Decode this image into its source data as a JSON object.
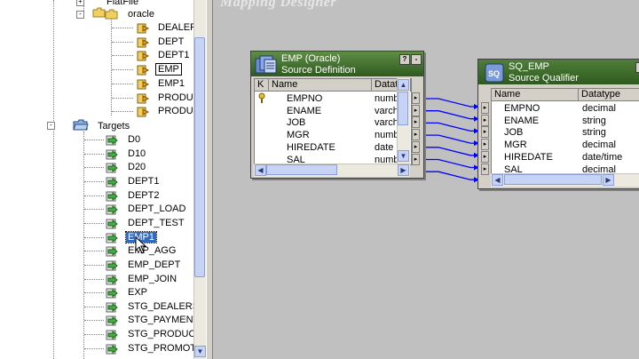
{
  "navigator": {
    "top_items": [
      {
        "label": "FlatFile",
        "kind": "folder",
        "expander": "+"
      },
      {
        "label": "oracle",
        "kind": "folder",
        "expander": "-"
      }
    ],
    "sources": [
      {
        "label": "DEALER"
      },
      {
        "label": "DEPT"
      },
      {
        "label": "DEPT1"
      },
      {
        "label": "EMP",
        "boxed": true
      },
      {
        "label": "EMP1"
      },
      {
        "label": "PRODUC"
      },
      {
        "label": "PRODUC"
      }
    ],
    "targets_label": "Targets",
    "targets": [
      {
        "label": "D0"
      },
      {
        "label": "D10"
      },
      {
        "label": "D20"
      },
      {
        "label": "DEPT1"
      },
      {
        "label": "DEPT2"
      },
      {
        "label": "DEPT_LOAD"
      },
      {
        "label": "DEPT_TEST"
      },
      {
        "label": "EMP1",
        "selected": true
      },
      {
        "label": "EMP_AGG"
      },
      {
        "label": "EMP_DEPT"
      },
      {
        "label": "EMP_JOIN"
      },
      {
        "label": "EXP"
      },
      {
        "label": "STG_DEALERSH"
      },
      {
        "label": "STG_PAYMENT"
      },
      {
        "label": "STG_PRODUCT"
      },
      {
        "label": "STG_PROMOTI"
      }
    ]
  },
  "workspace": {
    "title": "Mapping Designer",
    "source_def": {
      "title": "EMP (Oracle)",
      "subtitle": "Source Definition",
      "btn_help": "?",
      "btn_min": "-",
      "col_key": "K",
      "col_name": "Name",
      "col_type": "Datat",
      "rows": [
        {
          "key": "key",
          "name": "EMPNO",
          "type": "numb"
        },
        {
          "key": "",
          "name": "ENAME",
          "type": "varch"
        },
        {
          "key": "",
          "name": "JOB",
          "type": "varch"
        },
        {
          "key": "",
          "name": "MGR",
          "type": "numb"
        },
        {
          "key": "",
          "name": "HIREDATE",
          "type": "date"
        },
        {
          "key": "",
          "name": "SAL",
          "type": "numb"
        }
      ]
    },
    "qualifier": {
      "title": "SQ_EMP",
      "subtitle": "Source Qualifier",
      "btn_help": "?",
      "col_name": "Name",
      "col_type": "Datatype",
      "rows": [
        {
          "name": "EMPNO",
          "type": "decimal"
        },
        {
          "name": "ENAME",
          "type": "string"
        },
        {
          "name": "JOB",
          "type": "string"
        },
        {
          "name": "MGR",
          "type": "decimal"
        },
        {
          "name": "HIREDATE",
          "type": "date/time"
        },
        {
          "name": "SAL",
          "type": "decimal"
        }
      ]
    }
  },
  "colors": {
    "title_gradient_start": "#4f7f3a",
    "title_gradient_end": "#2f5a1f",
    "qualifier_title": "#3a6a2a",
    "link_color": "#0000ff",
    "selection": "#316ac5",
    "workspace_bg": "#c0c0c0"
  }
}
